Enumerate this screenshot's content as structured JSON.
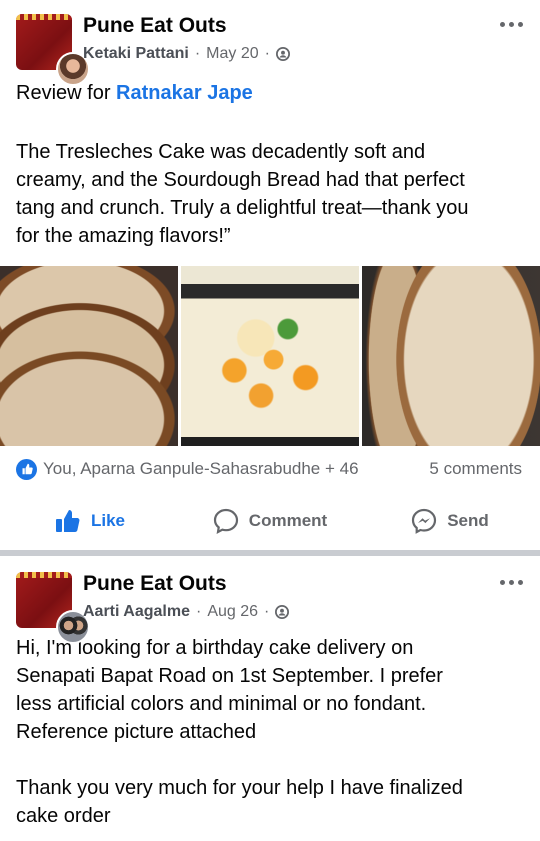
{
  "post1": {
    "group_name": "Pune Eat Outs",
    "author": "Ketaki Pattani",
    "date": "May 20",
    "separator": "·",
    "review_prefix": "Review for",
    "review_link": "Ratnakar Jape",
    "text_lines": [
      "The Tresleches Cake was decadently soft and",
      "creamy, and the Sourdough Bread had that perfect",
      "tang and crunch. Truly a delightful treat—thank you",
      "for the amazing flavors!”"
    ],
    "reactions_text": "You, Aparna Ganpule-Sahasrabudhe + 46",
    "comments_text": "5 comments",
    "actions": {
      "like": "Like",
      "comment": "Comment",
      "send": "Send"
    }
  },
  "post2": {
    "group_name": "Pune Eat Outs",
    "author": "Aarti Aagalme",
    "date": "Aug 26",
    "separator": "·",
    "text_lines": [
      "Hi, I'm looking for a birthday cake delivery on",
      "Senapati Bapat Road on 1st September. I prefer",
      "less artificial colors and minimal or no fondant.",
      "Reference picture attached"
    ],
    "text_lines_2": [
      "Thank you very much for your help I have finalized",
      "cake order"
    ]
  },
  "colors": {
    "link": "#1b74e4",
    "meta": "#65676b",
    "separator": "#c9ccd1"
  },
  "icons": {
    "more": "more-icon",
    "privacy": "friends-icon",
    "like": "thumbs-up-icon",
    "comment": "comment-bubble-icon",
    "send": "messenger-icon"
  }
}
